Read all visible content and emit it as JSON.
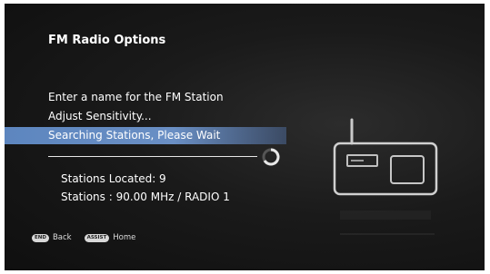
{
  "title": "FM Radio Options",
  "menu": {
    "items": [
      "Enter a name for the FM Station",
      "Adjust Sensitivity...",
      "Searching Stations, Please Wait"
    ]
  },
  "status": {
    "stations_located": "Stations Located: 9",
    "station_info": "Stations : 90.00 MHz / RADIO 1"
  },
  "footer": {
    "back_key": "END",
    "back_label": "Back",
    "home_key": "ASSIST",
    "home_label": "Home"
  },
  "colors": {
    "highlight": "#5d86bf",
    "background": "#1a1a1a"
  },
  "icons": [
    "spinner-icon",
    "radio-icon"
  ]
}
